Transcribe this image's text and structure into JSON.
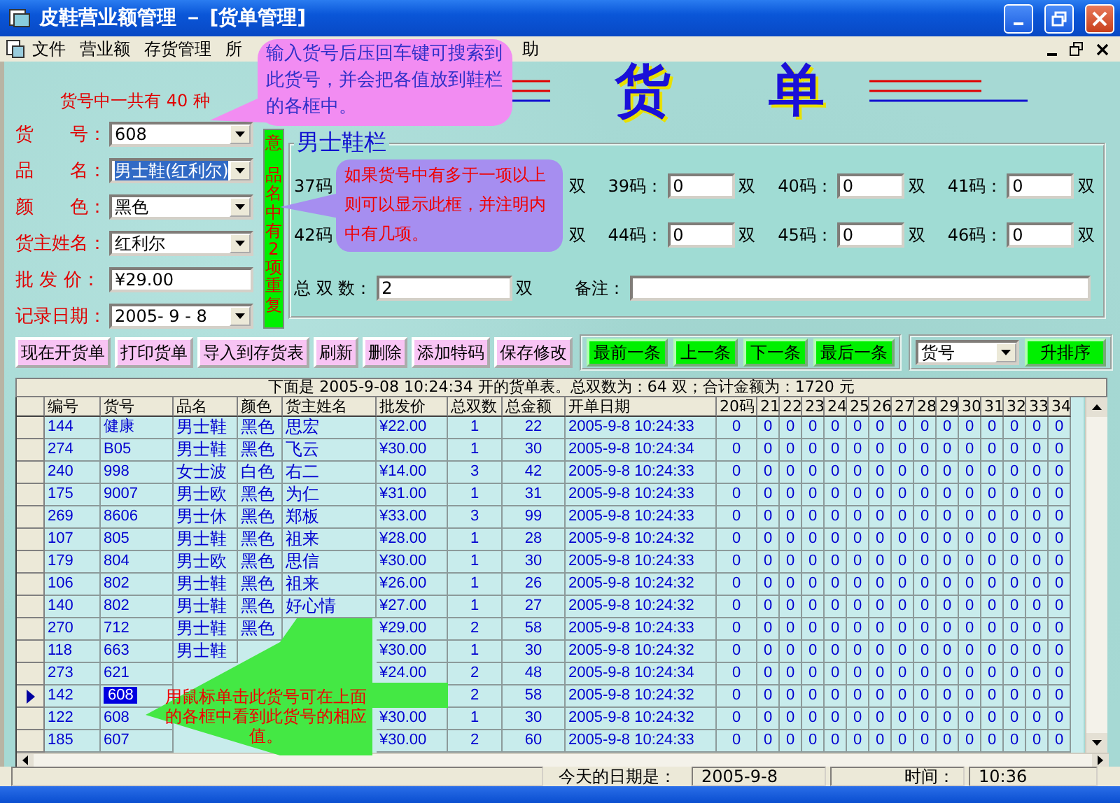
{
  "window": {
    "title": "皮鞋营业额管理 － [货单管理]"
  },
  "menu": [
    "文件",
    "营业额",
    "存货管理",
    "所",
    "助"
  ],
  "header": {
    "count_label": "货号中一共有 40 种",
    "title_chars": [
      "货",
      "单"
    ]
  },
  "form": {
    "fields": [
      {
        "label": "货　　号：",
        "value": "608",
        "kind": "combo",
        "text_selected": false
      },
      {
        "label": "品　　名：",
        "value": "男士鞋(红利尔)",
        "kind": "combo",
        "text_selected": true
      },
      {
        "label": "颜　　色：",
        "value": "黑色",
        "kind": "combo",
        "text_selected": false
      },
      {
        "label": "货主姓名：",
        "value": "红利尔",
        "kind": "combo",
        "text_selected": false
      },
      {
        "label": "批 发 价：",
        "value": "¥29.00",
        "kind": "text",
        "text_selected": false
      },
      {
        "label": "记录日期：",
        "value": "2005- 9 - 8",
        "kind": "combo",
        "text_selected": false
      }
    ]
  },
  "notice_strip": [
    "意",
    "品名中有2项重复"
  ],
  "size_panel": {
    "title": "男士鞋栏",
    "rows": [
      {
        "lead_label": "37码",
        "trailing_unit": "双",
        "fields": [
          {
            "label": "39码：",
            "value": "0",
            "unit": "双"
          },
          {
            "label": "40码：",
            "value": "0",
            "unit": "双"
          },
          {
            "label": "41码：",
            "value": "0",
            "unit": "双"
          }
        ]
      },
      {
        "lead_label": "42码",
        "trailing_unit": "双",
        "fields": [
          {
            "label": "44码：",
            "value": "0",
            "unit": "双"
          },
          {
            "label": "45码：",
            "value": "0",
            "unit": "双"
          },
          {
            "label": "46码：",
            "value": "0",
            "unit": "双"
          }
        ]
      }
    ],
    "total": {
      "label": "总 双 数：",
      "value": "2",
      "unit": "双"
    },
    "note": {
      "label": "备注："
    }
  },
  "actions": [
    "现在开货单",
    "打印货单",
    "导入到存货表",
    "刷新",
    "删除",
    "添加特码",
    "保存修改"
  ],
  "navigation": [
    "最前一条",
    "上一条",
    "下一条",
    "最后一条"
  ],
  "sort": {
    "field": "货号",
    "button": "升排序"
  },
  "table": {
    "caption": "下面是 2005-9-08 10:24:34 开的货单表。总双数为：64 双；合计金额为：1720 元",
    "columns": [
      "编号",
      "货号",
      "品名",
      "颜色",
      "货主姓名",
      "批发价",
      "总双数",
      "总金额",
      "开单日期",
      "20码",
      "21",
      "22",
      "23",
      "24",
      "25",
      "26",
      "27",
      "28",
      "29",
      "30",
      "31",
      "32",
      "33",
      "34"
    ],
    "rows": [
      {
        "selected": false,
        "cells": [
          "144",
          "健康",
          "男士鞋",
          "黑色",
          "思宏",
          "¥22.00",
          "1",
          "22",
          "2005-9-8 10:24:33"
        ],
        "sizes": [
          "0",
          "0",
          "0",
          "0",
          "0",
          "0",
          "0",
          "0",
          "0",
          "0",
          "0",
          "0",
          "0",
          "0",
          "0"
        ]
      },
      {
        "selected": false,
        "cells": [
          "274",
          "B05",
          "男士鞋",
          "黑色",
          "飞云",
          "¥30.00",
          "1",
          "30",
          "2005-9-8 10:24:34"
        ],
        "sizes": [
          "0",
          "0",
          "0",
          "0",
          "0",
          "0",
          "0",
          "0",
          "0",
          "0",
          "0",
          "0",
          "0",
          "0",
          "0"
        ]
      },
      {
        "selected": false,
        "cells": [
          "240",
          "998",
          "女士波",
          "白色",
          "右二",
          "¥14.00",
          "3",
          "42",
          "2005-9-8 10:24:33"
        ],
        "sizes": [
          "0",
          "0",
          "0",
          "0",
          "0",
          "0",
          "0",
          "0",
          "0",
          "0",
          "0",
          "0",
          "0",
          "0",
          "0"
        ]
      },
      {
        "selected": false,
        "cells": [
          "175",
          "9007",
          "男士欧",
          "黑色",
          "为仁",
          "¥31.00",
          "1",
          "31",
          "2005-9-8 10:24:33"
        ],
        "sizes": [
          "0",
          "0",
          "0",
          "0",
          "0",
          "0",
          "0",
          "0",
          "0",
          "0",
          "0",
          "0",
          "0",
          "0",
          "0"
        ]
      },
      {
        "selected": false,
        "cells": [
          "269",
          "8606",
          "男士休",
          "黑色",
          "郑板",
          "¥33.00",
          "3",
          "99",
          "2005-9-8 10:24:33"
        ],
        "sizes": [
          "0",
          "0",
          "0",
          "0",
          "0",
          "0",
          "0",
          "0",
          "0",
          "0",
          "0",
          "0",
          "0",
          "0",
          "0"
        ]
      },
      {
        "selected": false,
        "cells": [
          "107",
          "805",
          "男士鞋",
          "黑色",
          "祖来",
          "¥28.00",
          "1",
          "28",
          "2005-9-8 10:24:32"
        ],
        "sizes": [
          "0",
          "0",
          "0",
          "0",
          "0",
          "0",
          "0",
          "0",
          "0",
          "0",
          "0",
          "0",
          "0",
          "0",
          "0"
        ]
      },
      {
        "selected": false,
        "cells": [
          "179",
          "804",
          "男士欧",
          "黑色",
          "思信",
          "¥30.00",
          "1",
          "30",
          "2005-9-8 10:24:33"
        ],
        "sizes": [
          "0",
          "0",
          "0",
          "0",
          "0",
          "0",
          "0",
          "0",
          "0",
          "0",
          "0",
          "0",
          "0",
          "0",
          "0"
        ]
      },
      {
        "selected": false,
        "cells": [
          "106",
          "802",
          "男士鞋",
          "黑色",
          "祖来",
          "¥26.00",
          "1",
          "26",
          "2005-9-8 10:24:32"
        ],
        "sizes": [
          "0",
          "0",
          "0",
          "0",
          "0",
          "0",
          "0",
          "0",
          "0",
          "0",
          "0",
          "0",
          "0",
          "0",
          "0"
        ]
      },
      {
        "selected": false,
        "cells": [
          "140",
          "802",
          "男士鞋",
          "黑色",
          "好心情",
          "¥27.00",
          "1",
          "27",
          "2005-9-8 10:24:32"
        ],
        "sizes": [
          "0",
          "0",
          "0",
          "0",
          "0",
          "0",
          "0",
          "0",
          "0",
          "0",
          "0",
          "0",
          "0",
          "0",
          "0"
        ]
      },
      {
        "selected": false,
        "cells": [
          "270",
          "712",
          "男士鞋",
          "黑色",
          null,
          "¥29.00",
          "2",
          "58",
          "2005-9-8 10:24:33"
        ],
        "sizes": [
          "0",
          "0",
          "0",
          "0",
          "0",
          "0",
          "0",
          "0",
          "0",
          "0",
          "0",
          "0",
          "0",
          "0",
          "0"
        ]
      },
      {
        "selected": false,
        "cells": [
          "118",
          "663",
          "男士鞋",
          null,
          null,
          "¥30.00",
          "1",
          "30",
          "2005-9-8 10:24:32"
        ],
        "sizes": [
          "0",
          "0",
          "0",
          "0",
          "0",
          "0",
          "0",
          "0",
          "0",
          "0",
          "0",
          "0",
          "0",
          "0",
          "0"
        ]
      },
      {
        "selected": false,
        "cells": [
          "273",
          "621",
          null,
          null,
          null,
          "¥24.00",
          "2",
          "48",
          "2005-9-8 10:24:34"
        ],
        "sizes": [
          "0",
          "0",
          "0",
          "0",
          "0",
          "0",
          "0",
          "0",
          "0",
          "0",
          "0",
          "0",
          "0",
          "0",
          "0"
        ]
      },
      {
        "selected": true,
        "cells": [
          "142",
          "608",
          null,
          null,
          null,
          null,
          "2",
          "58",
          "2005-9-8 10:24:32"
        ],
        "sizes": [
          "0",
          "0",
          "0",
          "0",
          "0",
          "0",
          "0",
          "0",
          "0",
          "0",
          "0",
          "0",
          "0",
          "0",
          "0"
        ]
      },
      {
        "selected": false,
        "cells": [
          "122",
          "608",
          null,
          null,
          null,
          "¥30.00",
          "1",
          "30",
          "2005-9-8 10:24:32"
        ],
        "sizes": [
          "0",
          "0",
          "0",
          "0",
          "0",
          "0",
          "0",
          "0",
          "0",
          "0",
          "0",
          "0",
          "0",
          "0",
          "0"
        ]
      },
      {
        "selected": false,
        "cells": [
          "185",
          "607",
          null,
          null,
          null,
          "¥30.00",
          "2",
          "60",
          "2005-9-8 10:24:33"
        ],
        "sizes": [
          "0",
          "0",
          "0",
          "0",
          "0",
          "0",
          "0",
          "0",
          "0",
          "0",
          "0",
          "0",
          "0",
          "0",
          "0"
        ]
      }
    ]
  },
  "status_bar": {
    "date_label": "今天的日期是：",
    "date": "2005-9-8",
    "time_label": "时间：",
    "time": "10:36"
  },
  "callouts": [
    {
      "kind": "balloon_down",
      "text": "输入货号后压回车键可搜索到此货号，并会把各值放到鞋栏的各框中。"
    },
    {
      "kind": "balloon_left",
      "text": "如果货号中有多于一项以上则可以显示此框，并注明内中有几项。"
    },
    {
      "kind": "arrow_left",
      "text": "用鼠标单击此货号可在上面的各框中看到此货号的相应值。"
    }
  ]
}
